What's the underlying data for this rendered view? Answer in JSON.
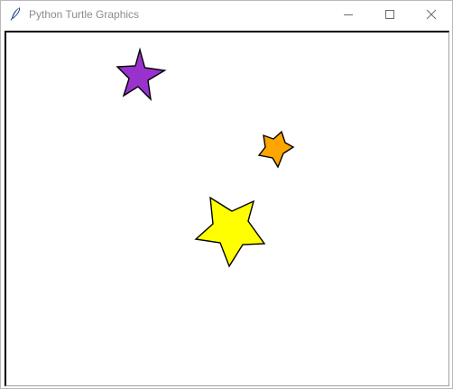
{
  "window": {
    "title": "Python Turtle Graphics",
    "icon": "feather-icon",
    "controls": {
      "minimize": "minimize-icon",
      "maximize": "maximize-icon",
      "close": "close-icon"
    }
  },
  "canvas": {
    "background": "#ffffff",
    "stars": [
      {
        "name": "purple-star",
        "fill": "#9932cc",
        "outline": "#000000"
      },
      {
        "name": "orange-star",
        "fill": "#ffa500",
        "outline": "#000000"
      },
      {
        "name": "yellow-star",
        "fill": "#ffff00",
        "outline": "#000000"
      }
    ]
  }
}
